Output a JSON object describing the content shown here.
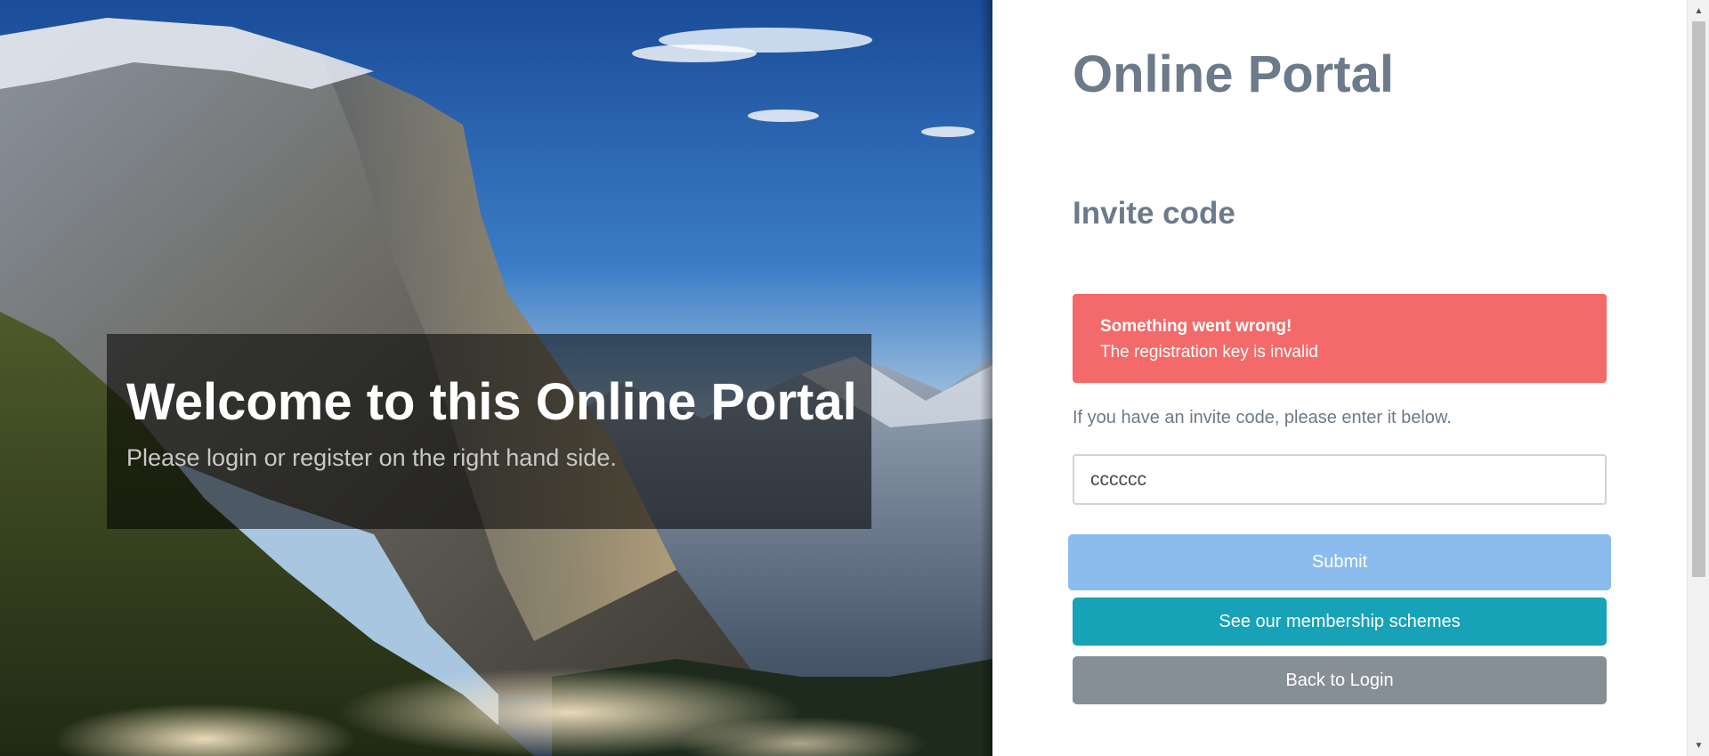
{
  "hero": {
    "title": "Welcome to this Online Portal",
    "subtitle": "Please login or register on the right hand side."
  },
  "panel": {
    "title": "Online Portal",
    "section_title": "Invite code",
    "alert": {
      "title": "Something went wrong!",
      "message": "The registration key is invalid",
      "color": "#f46a6a"
    },
    "hint": "If you have an invite code, please enter it below.",
    "invite_input": {
      "value": "cccccc",
      "placeholder": ""
    },
    "buttons": {
      "submit_label": "Submit",
      "membership_label": "See our membership schemes",
      "back_label": "Back to Login"
    },
    "colors": {
      "submit": "#8cbcee",
      "membership": "#17a2b8",
      "back": "#868e96",
      "heading": "#6c7a89"
    }
  },
  "scrollbar": {
    "up_icon": "scroll-up-arrow-icon",
    "down_icon": "scroll-down-arrow-icon"
  }
}
